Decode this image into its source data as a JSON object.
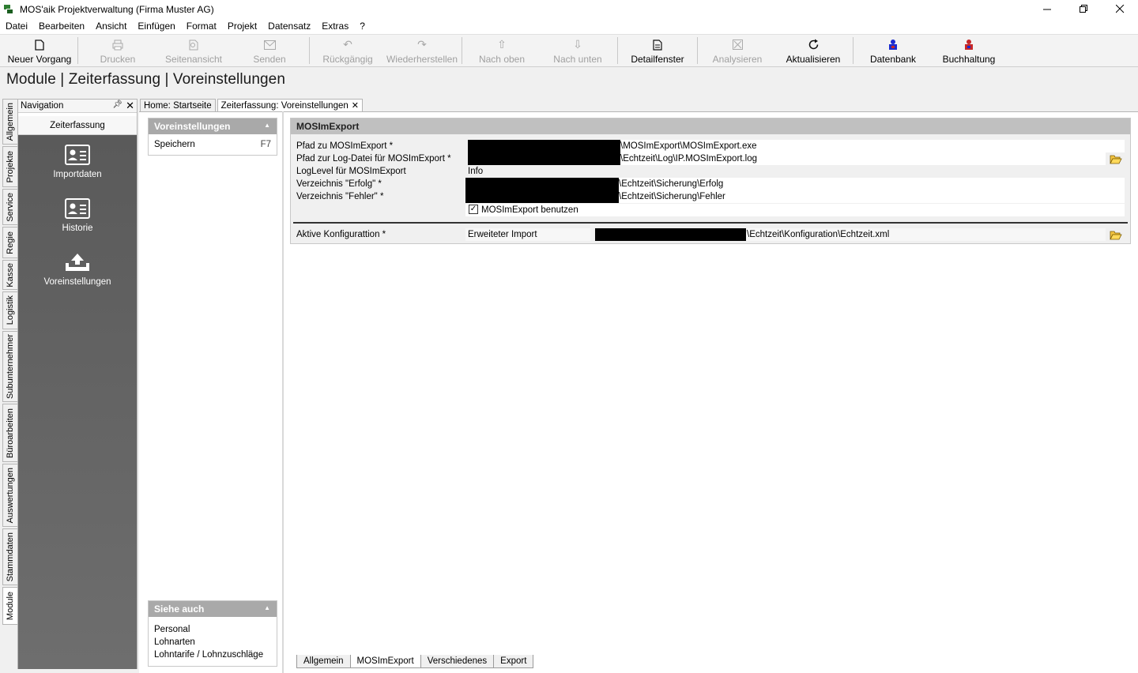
{
  "window": {
    "title": "MOS'aik Projektverwaltung (Firma Muster AG)"
  },
  "menu": [
    "Datei",
    "Bearbeiten",
    "Ansicht",
    "Einfügen",
    "Format",
    "Projekt",
    "Datensatz",
    "Extras",
    "?"
  ],
  "toolbar": {
    "new_label": "Neuer Vorgang",
    "print_label": "Drucken",
    "preview_label": "Seitenansicht",
    "send_label": "Senden",
    "undo_label": "Rückgängig",
    "redo_label": "Wiederherstellen",
    "up_label": "Nach oben",
    "down_label": "Nach unten",
    "detail_label": "Detailfenster",
    "analyze_label": "Analysieren",
    "refresh_label": "Aktualisieren",
    "db_label": "Datenbank",
    "accounting_label": "Buchhaltung"
  },
  "page_title": "Module | Zeiterfassung | Voreinstellungen",
  "vertical_tabs": [
    "Allgemein",
    "Projekte",
    "Service",
    "Regie",
    "Kasse",
    "Logistik",
    "Subunternehmer",
    "Büroarbeiten",
    "Auswertungen",
    "Stammdaten",
    "Module"
  ],
  "navigation": {
    "title": "Navigation",
    "section": "Zeiterfassung",
    "items": [
      "Importdaten",
      "Historie",
      "Voreinstellungen"
    ]
  },
  "doc_tabs": [
    "Home: Startseite",
    "Zeiterfassung: Voreinstellungen"
  ],
  "tasks": {
    "title": "Voreinstellungen",
    "save_label": "Speichern",
    "save_key": "F7"
  },
  "see_also": {
    "title": "Siehe auch",
    "items": [
      "Personal",
      "Lohnarten",
      "Lohntarife / Lohnzuschläge"
    ]
  },
  "group": {
    "title": "MOSImExport",
    "path_label": "Pfad zu MOSImExport *",
    "path_value": "\\MOSImExport\\MOSImExport.exe",
    "log_label": "Pfad zur Log-Datei für MOSImExport *",
    "log_value": "\\Echtzeit\\Log\\IP.MOSImExport.log",
    "loglevel_label": "LogLevel für MOSImExport",
    "loglevel_value": "Info",
    "success_label": "Verzeichnis \"Erfolg\" *",
    "success_value": "\\Echtzeit\\Sicherung\\Erfolg",
    "error_label": "Verzeichnis \"Fehler\" *",
    "error_value": "\\Echtzeit\\Sicherung\\Fehler",
    "use_label": "MOSImExport benutzen",
    "use_checked": true,
    "config_label": "Aktive Konfigurattion *",
    "config_type": "Erweiteter Import",
    "config_value": "\\Echtzeit\\Konfiguration\\Echtzeit.xml"
  },
  "bottom_tabs": [
    "Allgemein",
    "MOSImExport",
    "Verschiedenes",
    "Export"
  ]
}
